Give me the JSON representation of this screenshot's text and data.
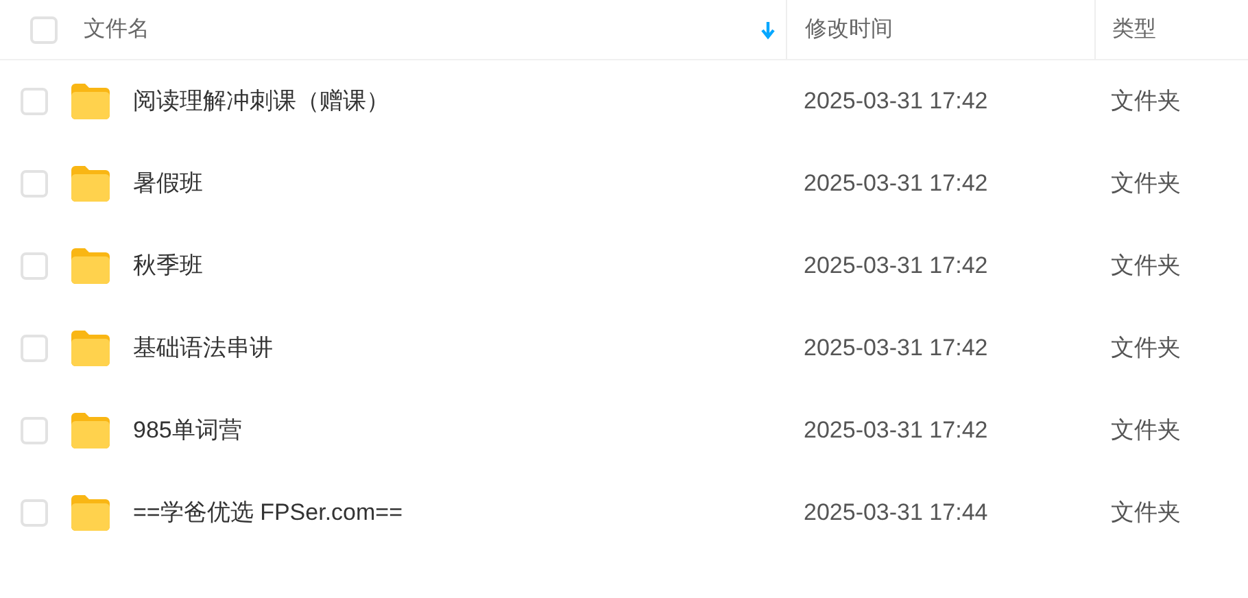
{
  "header": {
    "checked": false,
    "columns": [
      {
        "label": "文件名",
        "sorted": true
      },
      {
        "label": "修改时间",
        "sorted": false
      },
      {
        "label": "类型",
        "sorted": false
      }
    ]
  },
  "rows": [
    {
      "name": "阅读理解冲刺课（赠课）",
      "modified": "2025-03-31 17:42",
      "type": "文件夹",
      "checked": false
    },
    {
      "name": "暑假班",
      "modified": "2025-03-31 17:42",
      "type": "文件夹",
      "checked": false
    },
    {
      "name": "秋季班",
      "modified": "2025-03-31 17:42",
      "type": "文件夹",
      "checked": false
    },
    {
      "name": "基础语法串讲",
      "modified": "2025-03-31 17:42",
      "type": "文件夹",
      "checked": false
    },
    {
      "name": "985单词营",
      "modified": "2025-03-31 17:42",
      "type": "文件夹",
      "checked": false
    },
    {
      "name": "==学爸优选 FPSer.com==",
      "modified": "2025-03-31 17:44",
      "type": "文件夹",
      "checked": false
    }
  ]
}
